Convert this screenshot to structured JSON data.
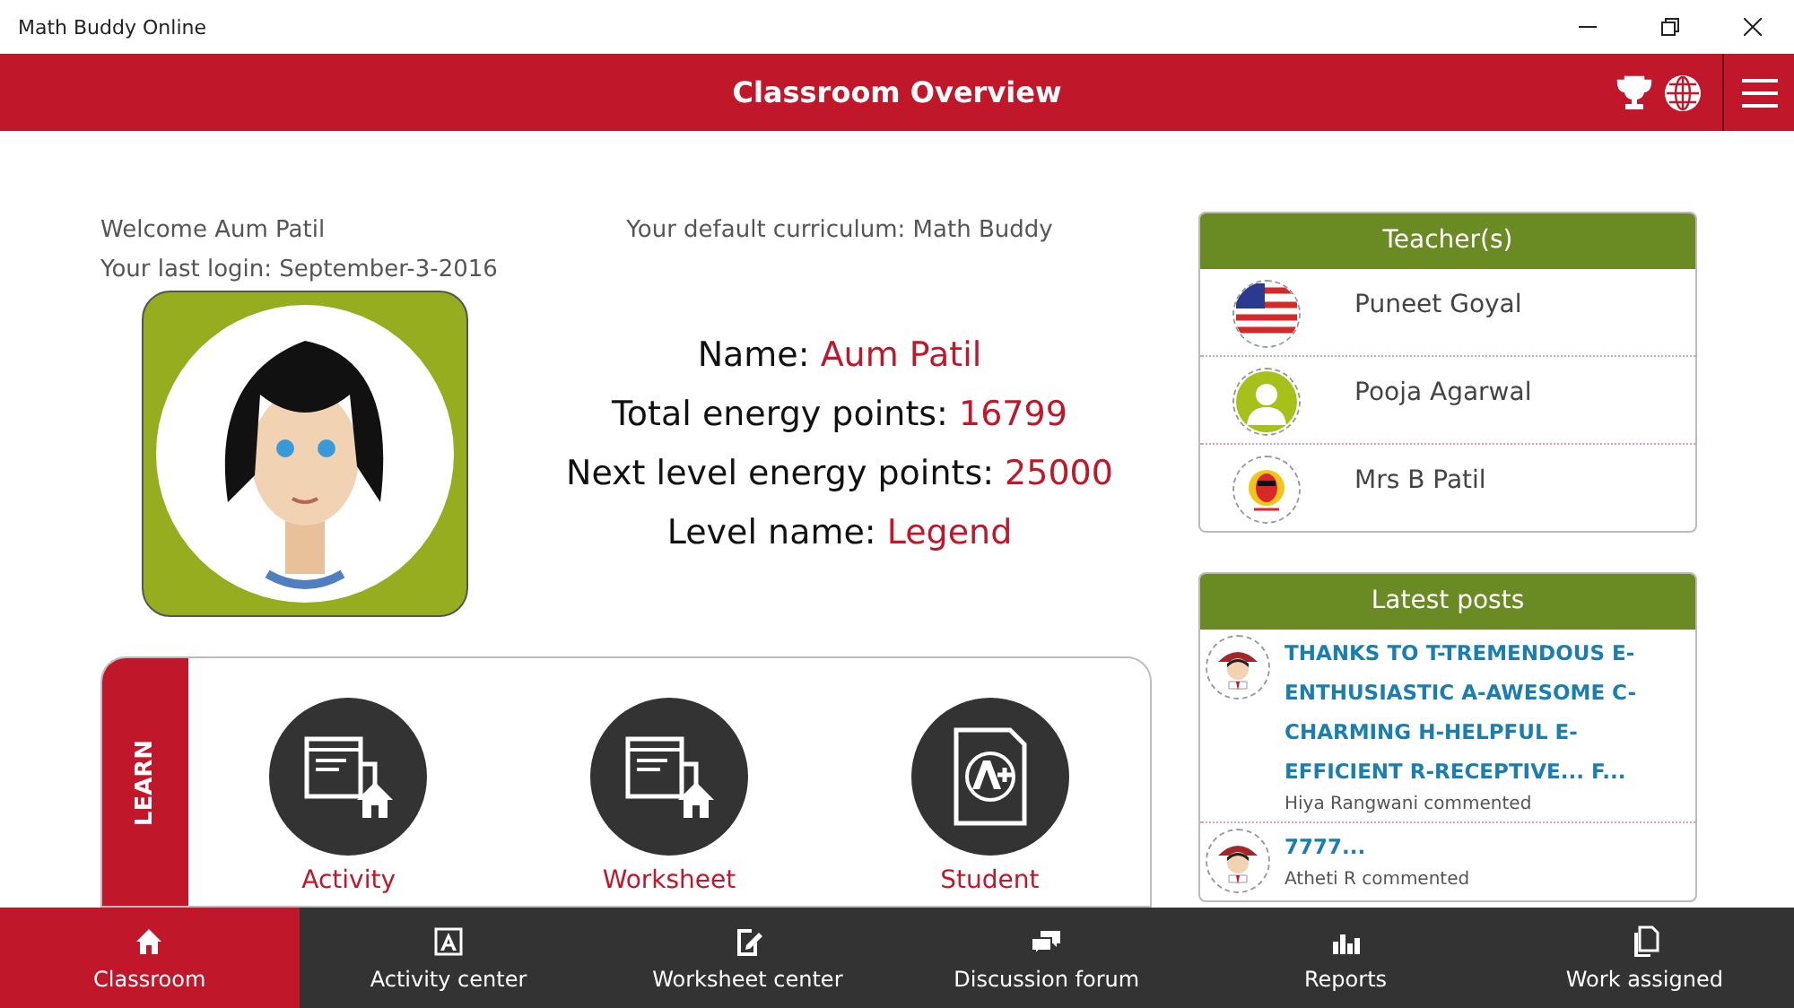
{
  "window": {
    "title": "Math Buddy Online"
  },
  "header": {
    "title": "Classroom Overview"
  },
  "profile": {
    "welcome": "Welcome Aum Patil",
    "last_login": "Your last login: September-3-2016",
    "curriculum": "Your default curriculum: Math Buddy",
    "stats": [
      {
        "label": "Name: ",
        "value": "Aum Patil"
      },
      {
        "label": "Total energy points: ",
        "value": "16799"
      },
      {
        "label": "Next level energy points: ",
        "value": "25000"
      },
      {
        "label": "Level name: ",
        "value": "Legend"
      }
    ]
  },
  "learn": {
    "tab": "LEARN",
    "items": [
      {
        "label": "Activity",
        "kind": "window-home"
      },
      {
        "label": "Worksheet",
        "kind": "window-home"
      },
      {
        "label": "Student",
        "kind": "grade"
      }
    ]
  },
  "teachers": {
    "title": "Teacher(s)",
    "items": [
      {
        "name": "Puneet Goyal",
        "kind": "flag"
      },
      {
        "name": "Pooja Agarwal",
        "kind": "person"
      },
      {
        "name": "Mrs B Patil",
        "kind": "badge"
      }
    ]
  },
  "posts": {
    "title": "Latest posts",
    "items": [
      {
        "text": "THANKS TO T-TREMENDOUS E-ENTHUSIASTIC A-AWESOME C-CHARMING H-HELPFUL E-EFFICIENT R-RECEPTIVE... F...",
        "author": "Hiya Rangwani commented"
      },
      {
        "text": "7777...",
        "author": "Atheti R commented"
      }
    ]
  },
  "nav": [
    {
      "label": "Classroom",
      "kind": "home",
      "selected": true
    },
    {
      "label": "Activity center",
      "kind": "letter",
      "selected": false
    },
    {
      "label": "Worksheet center",
      "kind": "edit",
      "selected": false
    },
    {
      "label": "Discussion forum",
      "kind": "chat",
      "selected": false
    },
    {
      "label": "Reports",
      "kind": "bars",
      "selected": false
    },
    {
      "label": "Work assigned",
      "kind": "copy",
      "selected": false
    }
  ]
}
